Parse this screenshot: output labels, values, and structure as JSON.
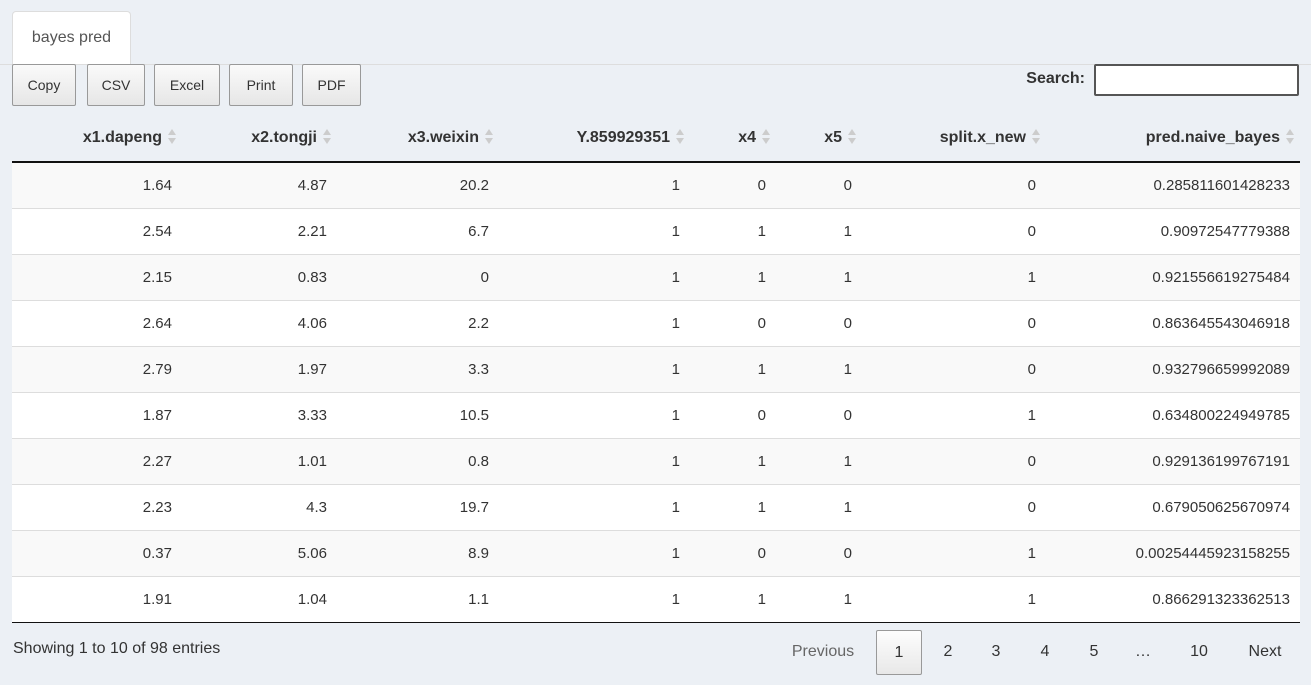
{
  "tab": {
    "label": "bayes pred"
  },
  "buttons": [
    "Copy",
    "CSV",
    "Excel",
    "Print",
    "PDF"
  ],
  "search": {
    "label": "Search:",
    "value": ""
  },
  "table": {
    "columns": [
      "x1.dapeng",
      "x2.tongji",
      "x3.weixin",
      "Y.859929351",
      "x4",
      "x5",
      "split.x_new",
      "pred.naive_bayes"
    ],
    "rows": [
      [
        "1.64",
        "4.87",
        "20.2",
        "1",
        "0",
        "0",
        "0",
        "0.285811601428233"
      ],
      [
        "2.54",
        "2.21",
        "6.7",
        "1",
        "1",
        "1",
        "0",
        "0.90972547779388"
      ],
      [
        "2.15",
        "0.83",
        "0",
        "1",
        "1",
        "1",
        "1",
        "0.921556619275484"
      ],
      [
        "2.64",
        "4.06",
        "2.2",
        "1",
        "0",
        "0",
        "0",
        "0.863645543046918"
      ],
      [
        "2.79",
        "1.97",
        "3.3",
        "1",
        "1",
        "1",
        "0",
        "0.932796659992089"
      ],
      [
        "1.87",
        "3.33",
        "10.5",
        "1",
        "0",
        "0",
        "1",
        "0.634800224949785"
      ],
      [
        "2.27",
        "1.01",
        "0.8",
        "1",
        "1",
        "1",
        "0",
        "0.929136199767191"
      ],
      [
        "2.23",
        "4.3",
        "19.7",
        "1",
        "1",
        "1",
        "0",
        "0.679050625670974"
      ],
      [
        "0.37",
        "5.06",
        "8.9",
        "1",
        "0",
        "0",
        "1",
        "0.00254445923158255"
      ],
      [
        "1.91",
        "1.04",
        "1.1",
        "1",
        "1",
        "1",
        "1",
        "0.866291323362513"
      ]
    ]
  },
  "info": "Showing 1 to 10 of 98 entries",
  "pagination": {
    "previous": "Previous",
    "pages": [
      "1",
      "2",
      "3",
      "4",
      "5",
      "…",
      "10"
    ],
    "current": "1",
    "next": "Next"
  }
}
